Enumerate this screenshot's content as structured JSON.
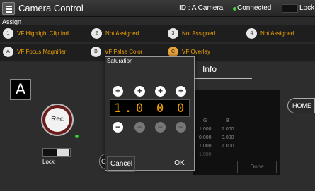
{
  "header": {
    "title": "Camera Control",
    "camera_id": "ID : A Camera",
    "connection": "Connected",
    "lock_label": "Lock -"
  },
  "assign": {
    "label": "Assign",
    "row1": [
      {
        "badge": "1",
        "label": "VF Highlight Clip Ind"
      },
      {
        "badge": "2",
        "label": "Not Assigned"
      },
      {
        "badge": "3",
        "label": "Not Assigned"
      },
      {
        "badge": "4",
        "label": "Not Assigned"
      }
    ],
    "row2": [
      {
        "badge": "A",
        "label": "VF Focus Magnifier"
      },
      {
        "badge": "B",
        "label": "VF False Color"
      },
      {
        "badge": "C",
        "label": "VF Overlay"
      }
    ]
  },
  "main": {
    "info_tab": "Info",
    "camera_letter": "A",
    "rec_label": "Rec",
    "lock_label": "Lock",
    "c_btn_label": "C",
    "home_label": "HOME",
    "info_table": {
      "headers": [
        "G",
        "B"
      ],
      "rows": [
        [
          "1.000",
          "1.000"
        ],
        [
          "0.000",
          "0.000"
        ],
        [
          "1.000",
          "1.000"
        ],
        [
          "1.000",
          ""
        ]
      ]
    },
    "done_label": "Done"
  },
  "dialog": {
    "title": "Saturation",
    "digits": [
      "1",
      ".",
      "0",
      "0",
      "0"
    ],
    "cancel_label": "Cancel",
    "ok_label": "OK"
  },
  "colors": {
    "accent": "#f0a000",
    "connected": "#3ccf3c",
    "rec_ring": "#6b1a1a"
  }
}
